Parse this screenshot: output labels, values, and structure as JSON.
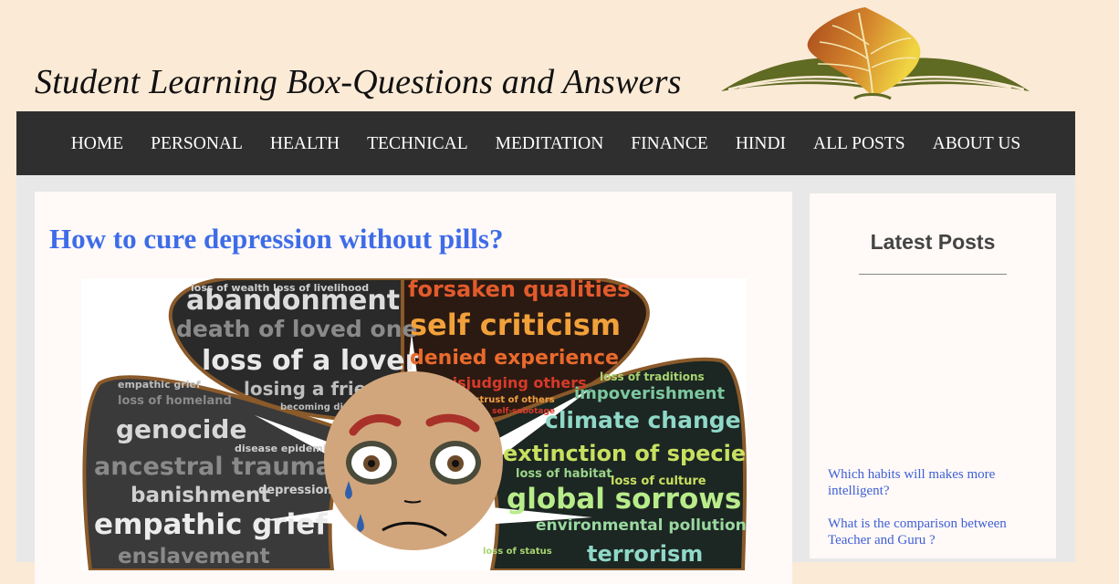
{
  "header": {
    "site_title": "Student Learning Box-Questions and Answers",
    "logo_icon": "open-book-with-leaf-logo"
  },
  "nav": {
    "items": [
      "HOME",
      "PERSONAL",
      "HEALTH",
      "TECHNICAL",
      "MEDITATION",
      "FINANCE",
      "HINDI",
      "ALL POSTS",
      "ABOUT US"
    ]
  },
  "post": {
    "title": "How to cure depression without pills?",
    "image_words": {
      "top_left": [
        "loss of wealth  loss of livelihood",
        "abandonment",
        "death of loved one",
        "loss of a lover",
        "losing a friend",
        "becoming disabled"
      ],
      "top_right": [
        "forsaken qualities",
        "self criticism",
        "denied experience",
        "misjudging others",
        "distrust of others",
        "self-sabotage"
      ],
      "left": [
        "empathic grief",
        "loss of homeland",
        "genocide",
        "ancestral trauma",
        "banishment",
        "empathic grief",
        "enslavement",
        "disease epidemics",
        "depression"
      ],
      "right": [
        "loss of traditions",
        "impoverishment",
        "climate change",
        "extinction of species",
        "loss of habitat",
        "loss of culture",
        "global sorrows",
        "environmental pollution",
        "terrorism",
        "loss of status"
      ]
    }
  },
  "sidebar": {
    "title": "Latest Posts",
    "posts": [
      "Which habits will makes more intelligent?",
      "What is the comparison between Teacher and Guru ?"
    ]
  },
  "colors": {
    "page_bg": "#fbead6",
    "nav_bg": "#2f2f2f",
    "title_blue": "#3e6ce8",
    "link_blue": "#3e5fd6"
  }
}
